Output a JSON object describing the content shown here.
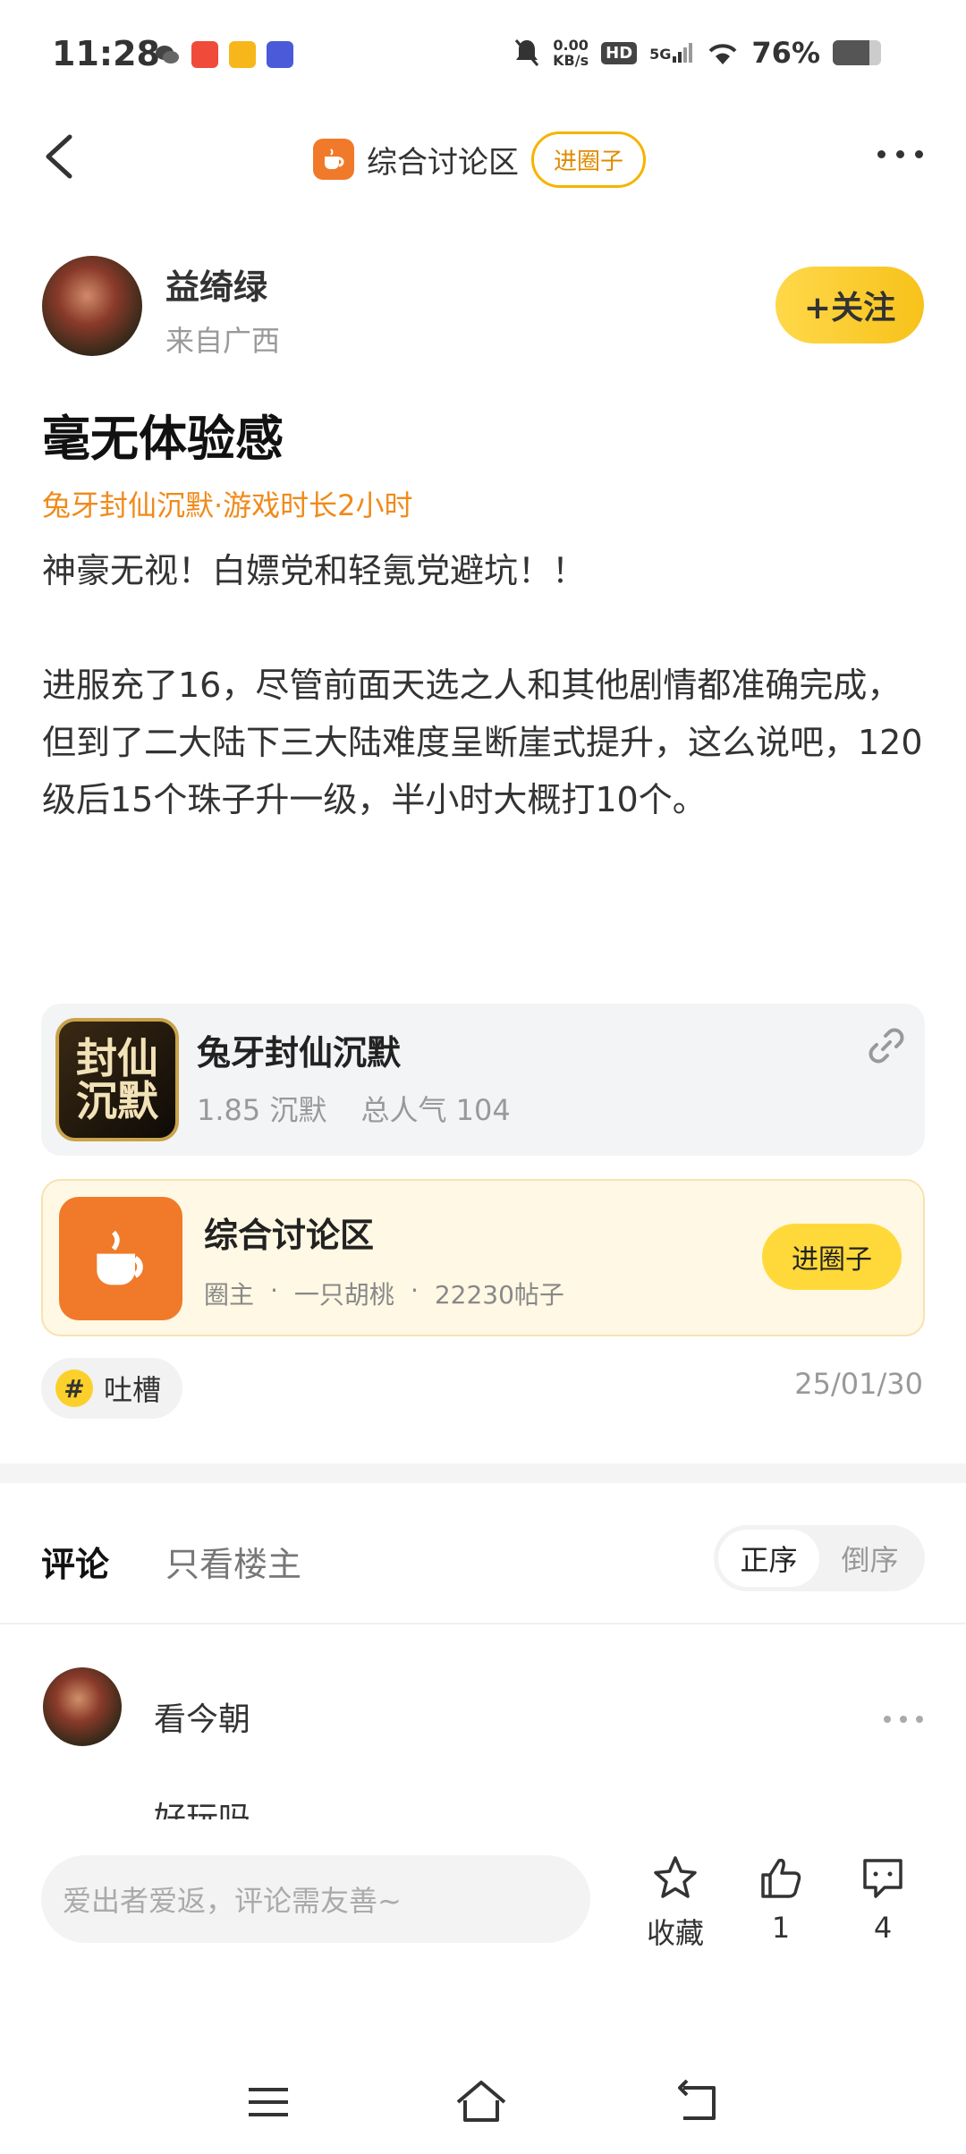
{
  "status_bar": {
    "time": "11:28",
    "net_speed_value": "0.00",
    "net_speed_unit": "KB/s",
    "hd": "HD",
    "signal": "5G",
    "battery": "76%",
    "battery_level": 0.76
  },
  "header": {
    "circle_name": "综合讨论区",
    "join_label": "进圈子"
  },
  "author": {
    "name": "益绮绿",
    "location": "来自广西",
    "follow_label": "+关注"
  },
  "post": {
    "title": "毫无体验感",
    "meta": "兔牙封仙沉默·游戏时长2小时",
    "paragraphs": [
      "神豪无视！白嫖党和轻氪党避坑！！",
      "进服充了16，尽管前面天选之人和其他剧情都准确完成，但到了二大陆下三大陆难度呈断崖式提升，这么说吧，120级后15个珠子升一级，半小时大概打10个。"
    ],
    "date": "25/01/30",
    "tag": "吐槽"
  },
  "game_card": {
    "icon_text_1": "封仙",
    "icon_text_2": "沉默",
    "name": "兔牙封仙沉默",
    "version": "1.85 沉默",
    "popularity": "总人气 104"
  },
  "circle_card": {
    "name": "综合讨论区",
    "owner_label": "圈主",
    "owner_name": "一只胡桃",
    "posts": "22230帖子",
    "join_label": "进圈子"
  },
  "comments": {
    "tab_all": "评论",
    "tab_op": "只看楼主",
    "sort_asc": "正序",
    "sort_desc": "倒序",
    "first": {
      "name": "看今朝",
      "text_peek": "好玩吗"
    }
  },
  "bottom_bar": {
    "input_placeholder": "爱出者爱返，评论需友善~",
    "favorite_label": "收藏",
    "like_count": "1",
    "comment_count": "4"
  },
  "colors": {
    "accent_yellow": "#ffd93a",
    "accent_orange": "#f07a2a",
    "meta_orange": "#f08a1a"
  }
}
